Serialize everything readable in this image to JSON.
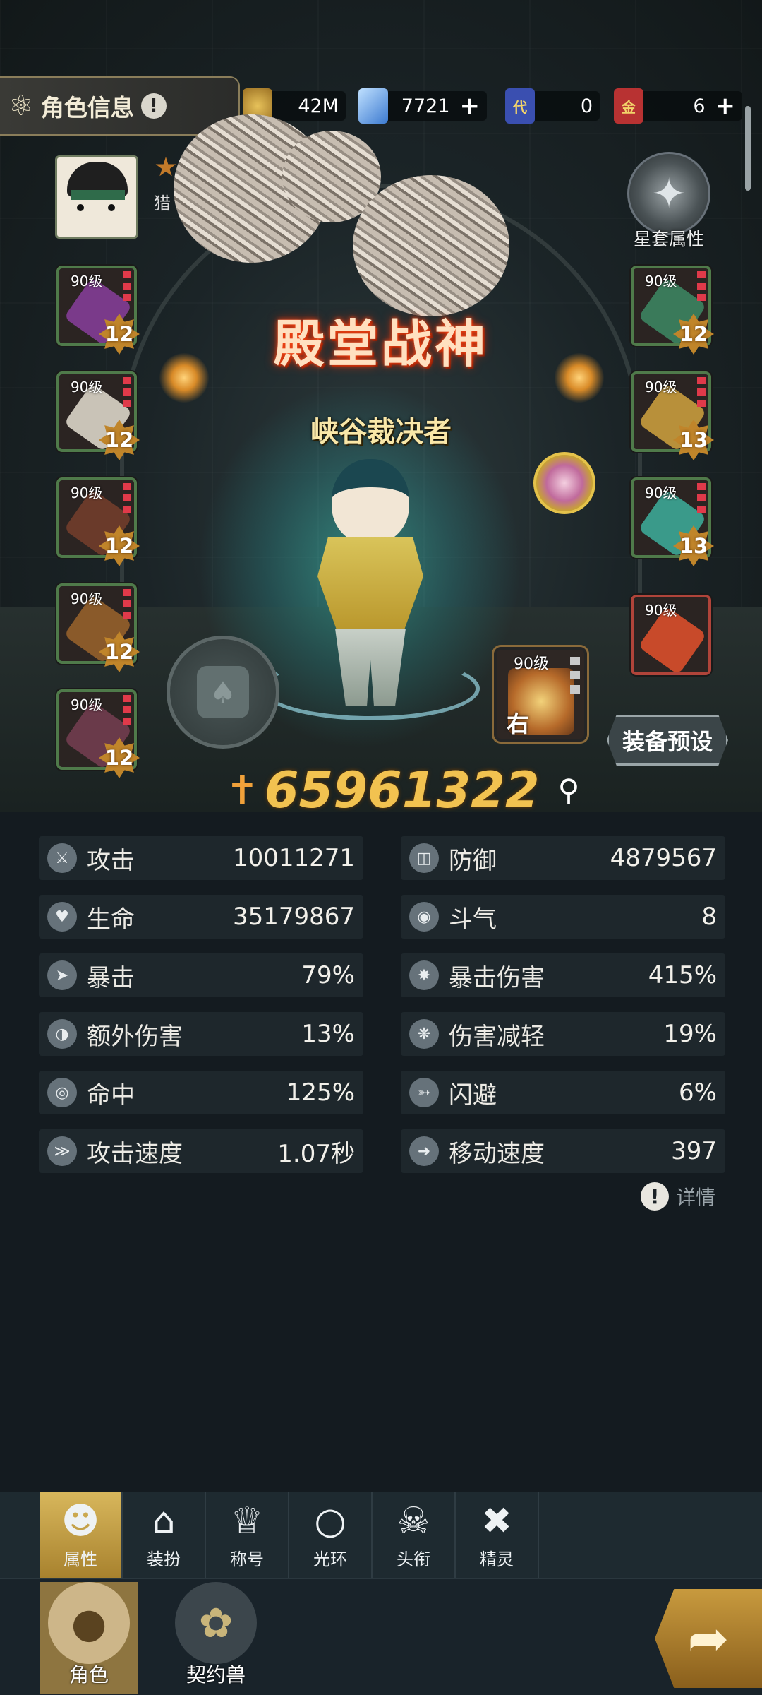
{
  "header": {
    "title": "角色信息",
    "title_icon": "character-icon",
    "help_icon": "!",
    "resources": [
      {
        "name": "gold-coin-icon",
        "value": "42M",
        "has_plus": false,
        "color": "#c89a3a"
      },
      {
        "name": "diamond-icon",
        "value": "7721",
        "has_plus": true,
        "color": "#6aa6e8"
      },
      {
        "name": "voucher-card-icon",
        "label": "代",
        "value": "0",
        "has_plus": false,
        "color": "#3a4fb0"
      },
      {
        "name": "gold-card-icon",
        "label": "金",
        "value": "6",
        "has_plus": true,
        "color": "#b83232"
      }
    ]
  },
  "player": {
    "name_char": "猎",
    "avatar_icon": "player-avatar"
  },
  "star_set": {
    "label": "星套属性",
    "icon": "star-emblem-icon"
  },
  "hall_title": "殿堂战神",
  "equip_title": "峡谷裁决者",
  "equipment_left": [
    {
      "level": "90级",
      "enhance": "12",
      "icon": "helmet-icon",
      "color": "#7a3a8a"
    },
    {
      "level": "90级",
      "enhance": "12",
      "icon": "shoulder-armor-icon",
      "color": "#c9c3b7"
    },
    {
      "level": "90级",
      "enhance": "12",
      "icon": "chest-armor-icon",
      "color": "#6a3a2a"
    },
    {
      "level": "90级",
      "enhance": "12",
      "icon": "belt-icon",
      "color": "#8a5a2a"
    },
    {
      "level": "90级",
      "enhance": "12",
      "icon": "pants-icon",
      "color": "#6a3a4a"
    }
  ],
  "equipment_right": [
    {
      "level": "90级",
      "enhance": "12",
      "icon": "weapon-icon",
      "color": "#3a7a5a"
    },
    {
      "level": "90级",
      "enhance": "13",
      "icon": "necklace-icon",
      "color": "#b8903a"
    },
    {
      "level": "90级",
      "enhance": "13",
      "icon": "bracelet-icon",
      "color": "#3a9a8a"
    },
    {
      "level": "90级",
      "enhance": "",
      "icon": "ring-icon",
      "color": "#c84a2a"
    }
  ],
  "side_slot": {
    "level": "90级",
    "tag": "右",
    "icon": "right-accessory-icon"
  },
  "preset_button": "装备预设",
  "combat_power": {
    "value": "65961322",
    "icon": "sword-icon"
  },
  "stats": [
    {
      "icon": "attack-icon",
      "label": "攻击",
      "value": "10011271"
    },
    {
      "icon": "defense-icon",
      "label": "防御",
      "value": "4879567"
    },
    {
      "icon": "life-icon",
      "label": "生命",
      "value": "35179867"
    },
    {
      "icon": "fighting-spirit-icon",
      "label": "斗气",
      "value": "8"
    },
    {
      "icon": "crit-icon",
      "label": "暴击",
      "value": "79%"
    },
    {
      "icon": "crit-damage-icon",
      "label": "暴击伤害",
      "value": "415%"
    },
    {
      "icon": "extra-damage-icon",
      "label": "额外伤害",
      "value": "13%"
    },
    {
      "icon": "damage-reduction-icon",
      "label": "伤害减轻",
      "value": "19%"
    },
    {
      "icon": "accuracy-icon",
      "label": "命中",
      "value": "125%"
    },
    {
      "icon": "dodge-icon",
      "label": "闪避",
      "value": "6%"
    },
    {
      "icon": "attack-speed-icon",
      "label": "攻击速度",
      "value": "1.07秒"
    },
    {
      "icon": "move-speed-icon",
      "label": "移动速度",
      "value": "397"
    }
  ],
  "details_link": "详情",
  "tabs": [
    {
      "label": "属性",
      "icon": "person-icon",
      "active": true
    },
    {
      "label": "装扮",
      "icon": "hanger-icon",
      "active": false
    },
    {
      "label": "称号",
      "icon": "crown-icon",
      "active": false
    },
    {
      "label": "光环",
      "icon": "halo-icon",
      "active": false
    },
    {
      "label": "头衔",
      "icon": "skull-icon",
      "active": false
    },
    {
      "label": "精灵",
      "icon": "spirit-icon",
      "active": false
    }
  ],
  "bottom_nav": [
    {
      "label": "角色",
      "icon": "character-head-icon",
      "active": true
    },
    {
      "label": "契约兽",
      "icon": "paw-icon",
      "active": false
    }
  ],
  "back_button_icon": "back-arrow-icon"
}
